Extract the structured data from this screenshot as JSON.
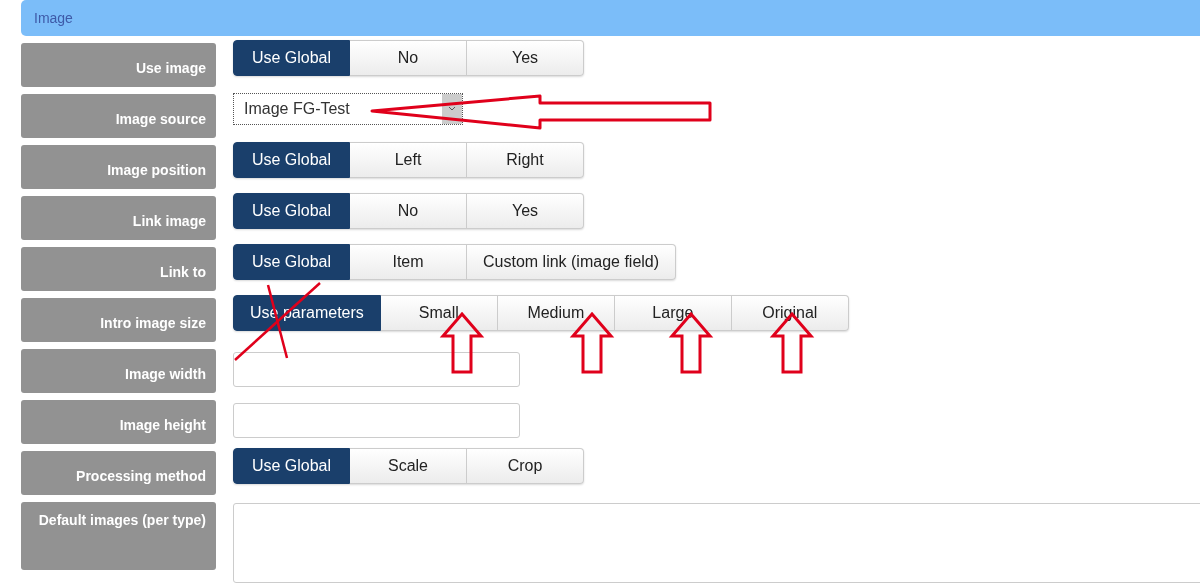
{
  "section": {
    "title": "Image"
  },
  "rows": [
    {
      "label": "Use image",
      "kind": "toggle",
      "options": [
        {
          "label": "Use Global",
          "selected": true
        },
        {
          "label": "No",
          "selected": false
        },
        {
          "label": "Yes",
          "selected": false
        }
      ]
    },
    {
      "label": "Image source",
      "kind": "select",
      "value": "Image FG-Test"
    },
    {
      "label": "Image position",
      "kind": "toggle",
      "options": [
        {
          "label": "Use Global",
          "selected": true
        },
        {
          "label": "Left",
          "selected": false
        },
        {
          "label": "Right",
          "selected": false
        }
      ]
    },
    {
      "label": "Link image",
      "kind": "toggle",
      "options": [
        {
          "label": "Use Global",
          "selected": true
        },
        {
          "label": "No",
          "selected": false
        },
        {
          "label": "Yes",
          "selected": false
        }
      ]
    },
    {
      "label": "Link to",
      "kind": "toggle",
      "options": [
        {
          "label": "Use Global",
          "selected": true
        },
        {
          "label": "Item",
          "selected": false
        },
        {
          "label": "Custom link (image field)",
          "selected": false
        }
      ]
    },
    {
      "label": "Intro image size",
      "kind": "toggle",
      "options": [
        {
          "label": "Use parameters",
          "selected": true
        },
        {
          "label": "Small",
          "selected": false
        },
        {
          "label": "Medium",
          "selected": false
        },
        {
          "label": "Large",
          "selected": false
        },
        {
          "label": "Original",
          "selected": false
        }
      ]
    },
    {
      "label": "Image width",
      "kind": "text"
    },
    {
      "label": "Image height",
      "kind": "text"
    },
    {
      "label": "Processing method",
      "kind": "toggle",
      "options": [
        {
          "label": "Use Global",
          "selected": true
        },
        {
          "label": "Scale",
          "selected": false
        },
        {
          "label": "Crop",
          "selected": false
        }
      ]
    },
    {
      "label": "Default images (per type)",
      "kind": "textarea"
    }
  ]
}
